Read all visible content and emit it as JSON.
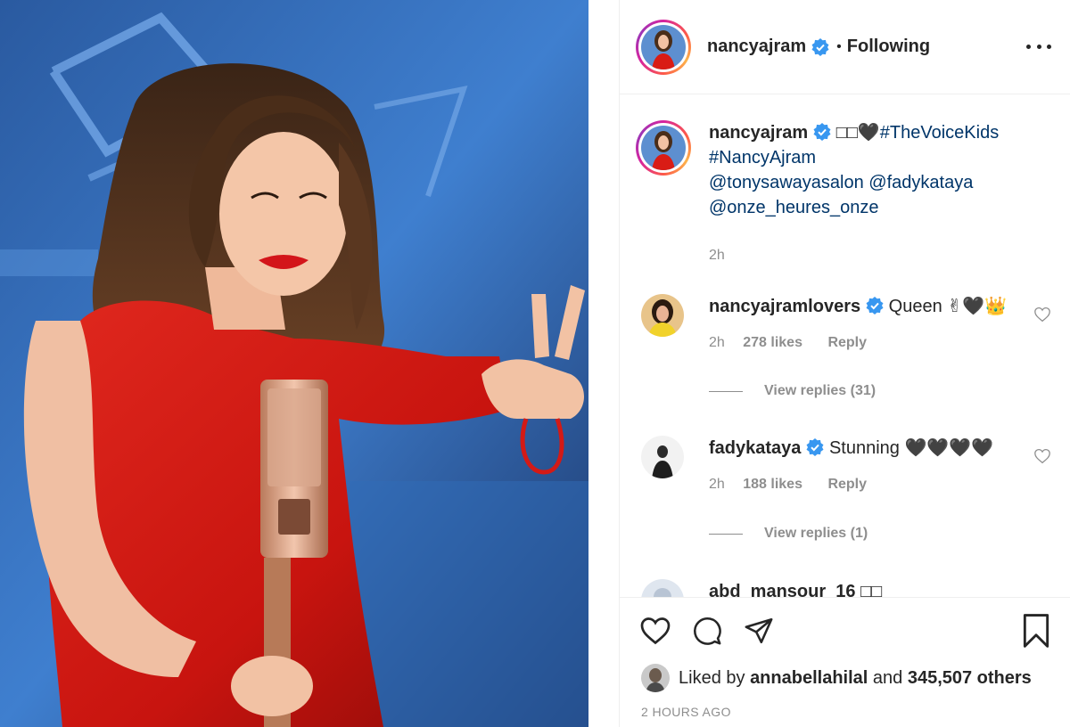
{
  "post": {
    "username": "nancyajram",
    "separator": "•",
    "follow_status": "Following",
    "caption": {
      "username": "nancyajram",
      "text_prefix": "□□🖤",
      "hashtag1": "#TheVoiceKids",
      "hashtag2": "#NancyAjram",
      "mention1": "@tonysawayasalon",
      "mention2": "@fadykataya",
      "mention3": "@onze_heures_onze",
      "time": "2h"
    },
    "comments": [
      {
        "username": "nancyajramlovers",
        "text": "Queen ✌🖤👑",
        "time": "2h",
        "likes": "278 likes",
        "reply": "Reply",
        "view_replies": "View replies (31)"
      },
      {
        "username": "fadykataya",
        "text": "Stunning 🖤🖤🖤🖤",
        "time": "2h",
        "likes": "188 likes",
        "reply": "Reply",
        "view_replies": "View replies (1)"
      },
      {
        "username": "abd_mansour_16",
        "text": "□□"
      }
    ],
    "liked_by_prefix": "Liked by",
    "liked_by_user": "annabellahilal",
    "liked_by_mid": "and",
    "liked_by_count": "345,507 others",
    "posted_ago": "2 HOURS AGO"
  },
  "icons": {
    "verified_color": "#3897f0",
    "like": "heart-icon",
    "comment": "comment-icon",
    "share": "share-icon",
    "save": "bookmark-icon",
    "more": "more-icon"
  }
}
